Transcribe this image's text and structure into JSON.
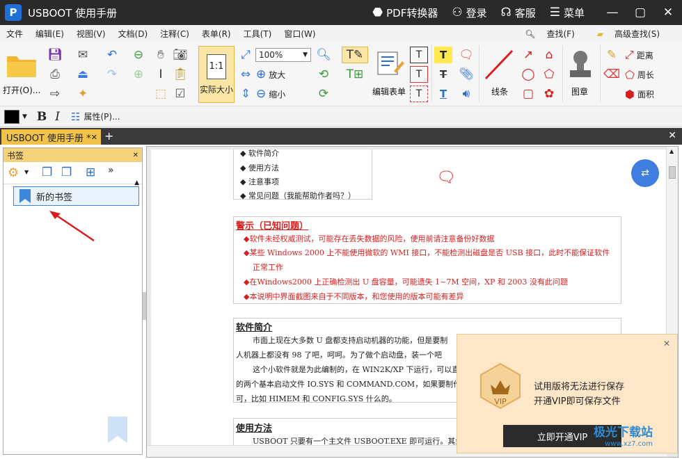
{
  "window": {
    "app_name": "USBOOT 使用手册",
    "actions": [
      {
        "icon": "pdf-convert-icon",
        "label": "PDF转换器"
      },
      {
        "icon": "user-icon",
        "label": "登录"
      },
      {
        "icon": "headset-icon",
        "label": "客服"
      },
      {
        "icon": "menu-icon",
        "label": "菜单"
      }
    ]
  },
  "menu": {
    "items": [
      "文件",
      "编辑(E)",
      "视图(V)",
      "文档(D)",
      "注释(C)",
      "表单(R)",
      "工具(T)",
      "窗口(W)"
    ],
    "find": "查找(F)",
    "advanced_find": "高级查找(S)"
  },
  "toolbar": {
    "open": "打开(O)...",
    "actual_size": "实际大小",
    "zoom": "100%",
    "zoom_in": "放大",
    "zoom_out": "缩小",
    "edit_form": "编辑表单",
    "lines": "线条",
    "stamp": "图章",
    "distance": "距离",
    "perimeter": "周长",
    "area": "面积",
    "properties": "属性(P)...",
    "actual_size_icon_text": "1:1"
  },
  "tabs": {
    "active": "USBOOT 使用手册 *"
  },
  "sidebar": {
    "title": "书签",
    "bookmark": "新的书签"
  },
  "document": {
    "toc": [
      "软件简介",
      "使用方法",
      "注意事项",
      "常见问题（我能帮助作者吗？）"
    ],
    "warning_title": "警示（已知问题）",
    "warnings": [
      "◆软件未经权威测试，可能存在丢失数据的风险，使用前请注意备份好数据",
      "◆某些 Windows 2000 上不能使用微软的 WMI 接口，不能检测出磁盘是否 USB 接口，此时不能保证软件",
      "正常工作",
      "◆在Windows2000 上正确检测出 U 盘容量，可能遗失 1~7M 空间，XP 和 2003 没有此问题",
      "◆本说明中界面截图来自于不同版本，和您使用的版本可能有差异"
    ],
    "intro_title": "软件简介",
    "intro_lines": [
      "市面上现在大多数 U 盘都支持启动机器的功能，但是要制",
      "人机器上都没有 98 了吧，呵呵。为了做个启动盘，装一个吧",
      "这个小软件就是为此编制的，在 WIN2K/XP 下运行，可以直",
      "的两个基本启动文件 IO.SYS 和 COMMAND.COM，如果要制作复杂",
      "可，比如 HIMEM 和 CONFIG.SYS 什么的。"
    ],
    "usage_title": "使用方法",
    "usage_line": "USBOOT 只要有一个主文件 USBOOT.EXE 即可运行。其余的"
  },
  "vip": {
    "line1": "试用版将无法进行保存",
    "line2": "开通VIP即可保存文件",
    "button": "立即开通VIP",
    "badge": "VIP"
  },
  "watermark": {
    "name": "极光下载站",
    "url": "www.xz7.com"
  },
  "colors": {
    "accent": "#f0c24a",
    "warning": "#d81e1e",
    "titlebar": "#2a2a2a"
  }
}
